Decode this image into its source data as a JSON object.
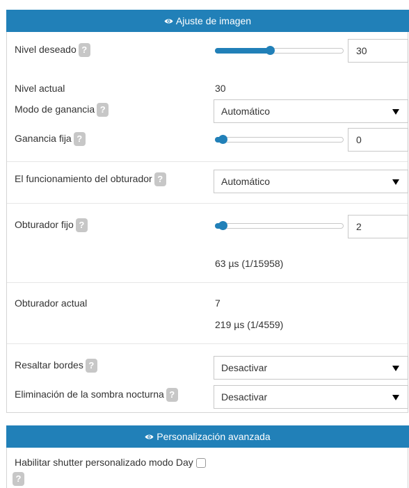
{
  "panel1": {
    "title": "Ajuste de imagen",
    "nivel_deseado": {
      "label": "Nivel deseado",
      "help": "?",
      "value": "30",
      "slider_fraction": 0.43
    },
    "nivel_actual": {
      "label": "Nivel actual",
      "value": "30"
    },
    "modo_ganancia": {
      "label": "Modo de ganancia",
      "help": "?",
      "selected": "Automático"
    },
    "ganancia_fija": {
      "label": "Ganancia fija",
      "help": "?",
      "value": "0",
      "slider_fraction": 0.06
    },
    "obturador_modo": {
      "label": "El funcionamiento del obturador",
      "help": "?",
      "selected": "Automático"
    },
    "obturador_fijo": {
      "label": "Obturador fijo",
      "help": "?",
      "value": "2",
      "slider_fraction": 0.06,
      "time": "63 µs (1/15958)"
    },
    "obturador_actual": {
      "label": "Obturador actual",
      "value": "7",
      "time": "219 µs (1/4559)"
    },
    "resaltar_bordes": {
      "label": "Resaltar bordes",
      "help": "?",
      "selected": "Desactivar"
    },
    "sombra_nocturna": {
      "label": "Eliminación de la sombra nocturna",
      "help": "?",
      "selected": "Desactivar"
    }
  },
  "panel2": {
    "title": "Personalización avanzada",
    "shutter_day": {
      "label": "Habilitar shutter personalizado modo Day",
      "help": "?",
      "checked": false
    }
  },
  "colors": {
    "header": "#2180b8",
    "accent": "#2180b8",
    "help_badge": "#c7c7c7"
  },
  "icons": {
    "header_icon": "eye-icon",
    "dropdown": "caret-down-icon",
    "help": "question-icon"
  }
}
